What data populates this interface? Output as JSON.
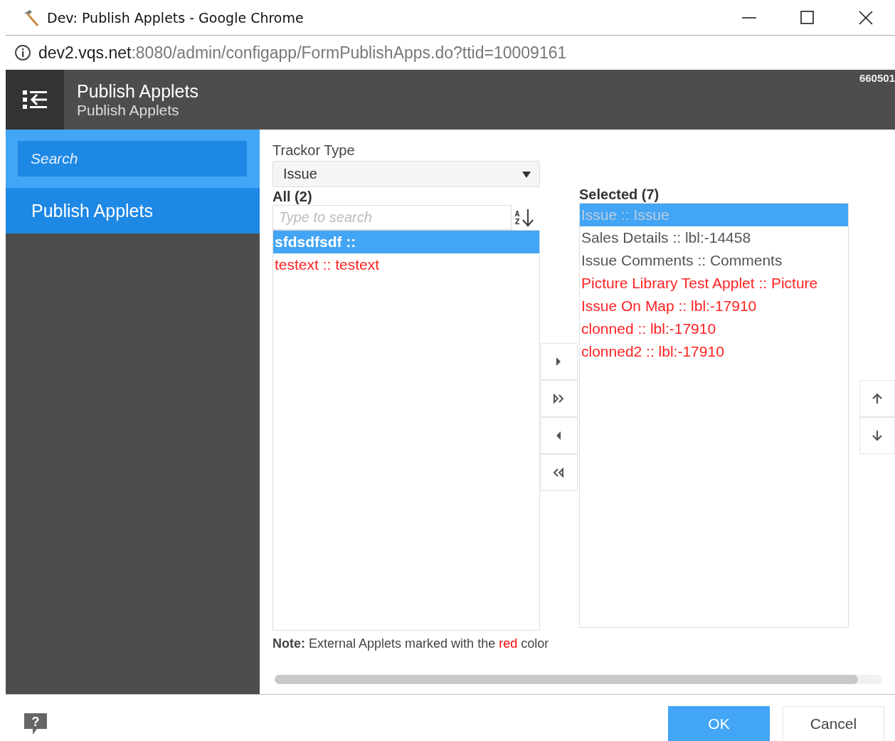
{
  "window": {
    "title": "Dev: Publish Applets - Google Chrome"
  },
  "address_bar": {
    "host": "dev2.vqs.net",
    "path": ":8080/admin/configapp/FormPublishApps.do?ttid=10009161"
  },
  "header": {
    "title": "Publish Applets",
    "subtitle": "Publish Applets",
    "counter": "660501"
  },
  "sidebar": {
    "search_placeholder": "Search",
    "items": [
      {
        "label": "Publish Applets",
        "selected": true
      }
    ]
  },
  "trackor_type": {
    "label": "Trackor Type",
    "value": "Issue"
  },
  "all_list": {
    "heading": "All (2)",
    "search_placeholder": "Type to search",
    "sort_label": "A Z",
    "items": [
      {
        "label": "sfdsdfsdf ::",
        "selected": true,
        "external": false
      },
      {
        "label": "testext :: testext",
        "selected": false,
        "external": true
      }
    ]
  },
  "transfer_buttons": [
    {
      "kind": "add"
    },
    {
      "kind": "add_all"
    },
    {
      "kind": "remove"
    },
    {
      "kind": "remove_all"
    }
  ],
  "selected_list": {
    "heading": "Selected (7)",
    "items": [
      {
        "label": "Issue :: Issue",
        "selected": true,
        "external": false
      },
      {
        "label": "Sales Details :: lbl:-14458",
        "selected": false,
        "external": false
      },
      {
        "label": "Issue Comments :: Comments",
        "selected": false,
        "external": false
      },
      {
        "label": "Picture Library Test Applet :: Picture",
        "selected": false,
        "external": true
      },
      {
        "label": "Issue On Map :: lbl:-17910",
        "selected": false,
        "external": true
      },
      {
        "label": "clonned :: lbl:-17910",
        "selected": false,
        "external": true
      },
      {
        "label": "clonned2 :: lbl:-17910",
        "selected": false,
        "external": true
      }
    ]
  },
  "order_buttons": [
    {
      "kind": "up"
    },
    {
      "kind": "down"
    }
  ],
  "note": {
    "label": "Note:",
    "before": "External Applets marked with the ",
    "highlight": "red",
    "after": " color"
  },
  "help": {
    "glyph": "?"
  },
  "buttons": [
    {
      "label": "OK",
      "kind": "primary"
    },
    {
      "label": "Cancel",
      "kind": "secondary"
    }
  ]
}
